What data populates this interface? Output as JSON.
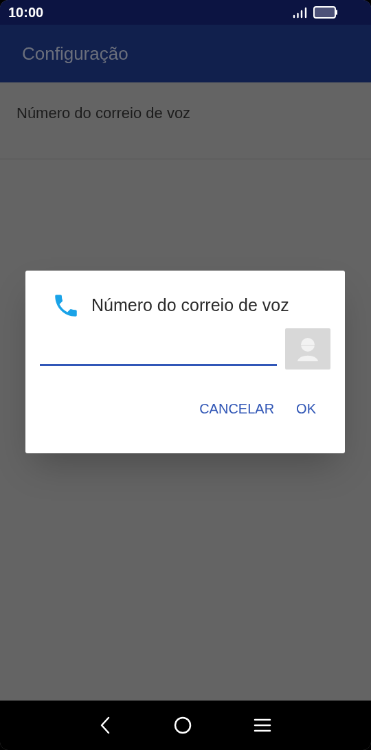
{
  "status_bar": {
    "time": "10:00"
  },
  "app_bar": {
    "title": "Configuração"
  },
  "settings": [
    {
      "title": "Número do correio de voz"
    }
  ],
  "dialog": {
    "title": "Número do correio de voz",
    "buttons": [
      "CANCELAR",
      "OK"
    ]
  }
}
